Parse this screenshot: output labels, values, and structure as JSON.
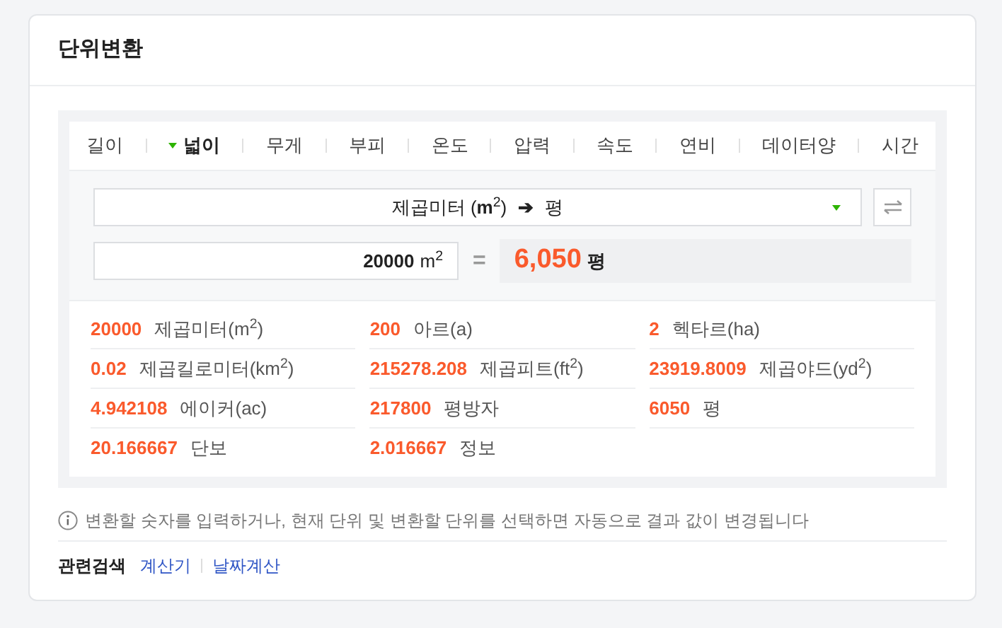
{
  "title": "단위변환",
  "tabs": [
    {
      "label": "길이",
      "selected": false
    },
    {
      "label": "넓이",
      "selected": true
    },
    {
      "label": "무게",
      "selected": false
    },
    {
      "label": "부피",
      "selected": false
    },
    {
      "label": "온도",
      "selected": false
    },
    {
      "label": "압력",
      "selected": false
    },
    {
      "label": "속도",
      "selected": false
    },
    {
      "label": "연비",
      "selected": false
    },
    {
      "label": "데이터양",
      "selected": false
    },
    {
      "label": "시간",
      "selected": false
    }
  ],
  "unit_select": {
    "from": "제곱미터 (**m**$^{2}$)",
    "arrow": "➔",
    "to": "평"
  },
  "input": {
    "value": "20000",
    "unit": "m$^{2}$"
  },
  "equals": "=",
  "result": {
    "value": "6,050",
    "unit": "평"
  },
  "conversions": [
    {
      "value": "20000",
      "unit": "제곱미터(m$^{2}$)"
    },
    {
      "value": "200",
      "unit": "아르(a)"
    },
    {
      "value": "2",
      "unit": "헥타르(ha)"
    },
    {
      "value": "0.02",
      "unit": "제곱킬로미터(km$^{2}$)"
    },
    {
      "value": "215278.208",
      "unit": "제곱피트(ft$^{2}$)"
    },
    {
      "value": "23919.8009",
      "unit": "제곱야드(yd$^{2}$)"
    },
    {
      "value": "4.942108",
      "unit": "에이커(ac)"
    },
    {
      "value": "217800",
      "unit": "평방자"
    },
    {
      "value": "6050",
      "unit": "평"
    },
    {
      "value": "20.166667",
      "unit": "단보"
    },
    {
      "value": "2.016667",
      "unit": "정보"
    }
  ],
  "info": "변환할 숫자를 입력하거나, 현재 단위 및 변환할 단위를 선택하면 자동으로 결과 값이 변경됩니다",
  "related": {
    "label": "관련검색",
    "links": [
      "계산기",
      "날짜계산"
    ]
  }
}
